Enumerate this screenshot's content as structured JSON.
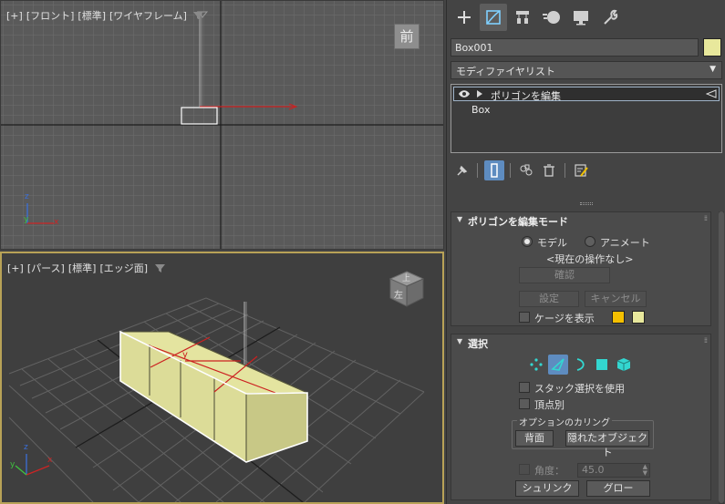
{
  "viewports": {
    "front": {
      "labels": [
        "[+]",
        "[フロント]",
        "[標準]",
        "[ワイヤフレーム]"
      ],
      "viewcube_label": "前",
      "axis_labels": {
        "z": "z",
        "y": "y",
        "x": "x"
      }
    },
    "perspective": {
      "labels": [
        "[+]",
        "[パース]",
        "[標準]",
        "[エッジ面]"
      ],
      "viewcube_top": "上",
      "viewcube_front": "左",
      "axis_labels": {
        "z": "z",
        "y": "y",
        "x": "x"
      },
      "gizmo_label": "y"
    }
  },
  "command_panel": {
    "tabs": [
      {
        "name": "create",
        "icon": "plus-icon"
      },
      {
        "name": "modify",
        "icon": "modify-icon",
        "active": true
      },
      {
        "name": "hierarchy",
        "icon": "hierarchy-icon"
      },
      {
        "name": "motion",
        "icon": "motion-icon"
      },
      {
        "name": "display",
        "icon": "display-icon"
      },
      {
        "name": "utilities",
        "icon": "wrench-icon"
      }
    ],
    "object_name": "Box001",
    "object_color": "#e8e89c",
    "modifier_list_label": "モディファイヤリスト",
    "stack": {
      "modifier": "ポリゴンを編集",
      "base": "Box"
    },
    "edit_mode": {
      "title": "ポリゴンを編集モード",
      "model_label": "モデル",
      "animate_label": "アニメート",
      "current_op": "<現在の操作なし>",
      "commit_label": "確認",
      "settings_label": "設定",
      "cancel_label": "キャンセル",
      "show_cage_label": "ケージを表示",
      "cage_color_1": "#f5c000",
      "cage_color_2": "#e8e89c"
    },
    "selection": {
      "title": "選択",
      "use_stack_label": "スタック選択を使用",
      "by_vertex_label": "頂点別",
      "culling_group_label": "オプションのカリング",
      "backface_label": "背面",
      "occluded_label": "隠れたオブジェクト",
      "angle_label": "角度：",
      "angle_value": "45.0",
      "shrink_label": "シュリンク",
      "grow_label": "グロー"
    }
  }
}
